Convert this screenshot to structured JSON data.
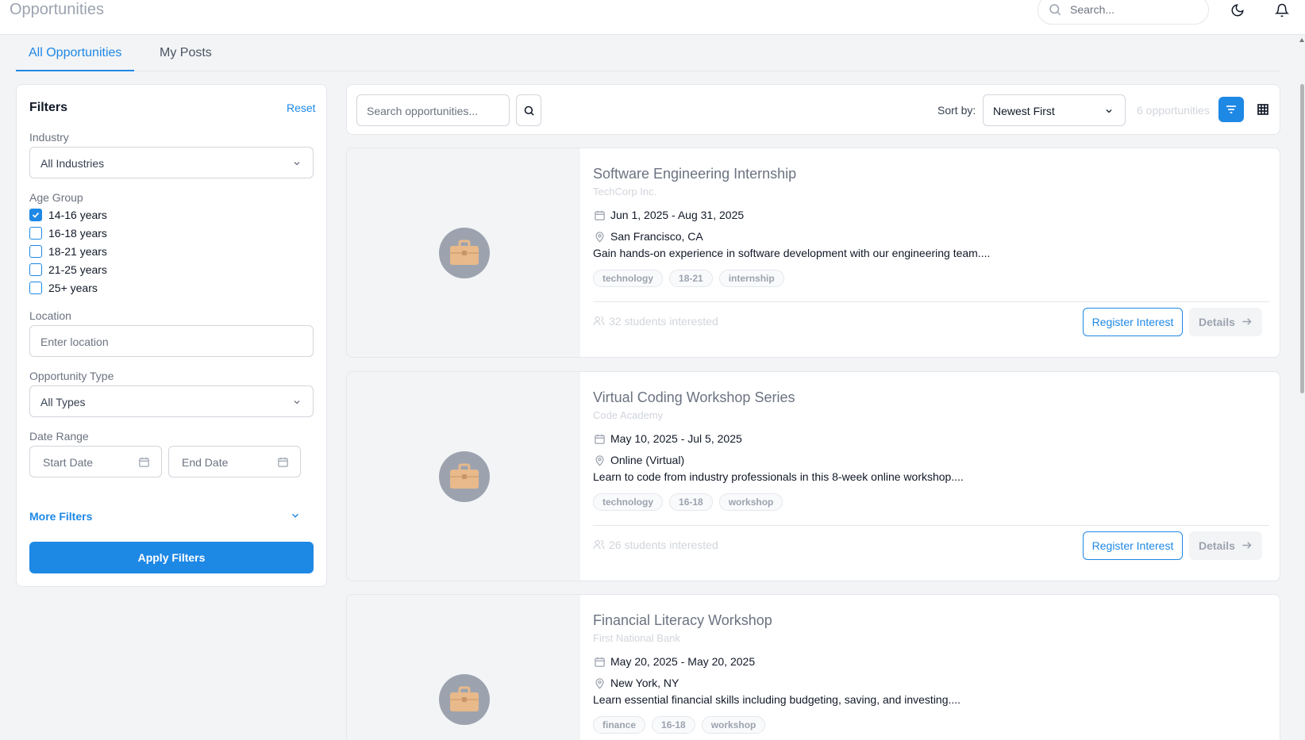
{
  "header": {
    "title": "Opportunities",
    "search_placeholder": "Search...",
    "icons": [
      "search-icon",
      "moon-icon",
      "bell-icon"
    ]
  },
  "tabs": [
    {
      "label": "All Opportunities",
      "active": true
    },
    {
      "label": "My Posts",
      "active": false
    }
  ],
  "filters": {
    "title": "Filters",
    "reset_label": "Reset",
    "industry": {
      "label": "Industry",
      "value": "All Industries"
    },
    "age_group": {
      "label": "Age Group",
      "options": [
        {
          "label": "14-16 years",
          "checked": true
        },
        {
          "label": "16-18 years",
          "checked": false
        },
        {
          "label": "18-21 years",
          "checked": false
        },
        {
          "label": "21-25 years",
          "checked": false
        },
        {
          "label": "25+ years",
          "checked": false
        }
      ]
    },
    "location": {
      "label": "Location",
      "placeholder": "Enter location"
    },
    "opportunity_type": {
      "label": "Opportunity Type",
      "value": "All Types"
    },
    "date_range": {
      "label": "Date Range",
      "start_placeholder": "Start Date",
      "end_placeholder": "End Date"
    },
    "more_filters_label": "More Filters",
    "apply_label": "Apply Filters"
  },
  "toolbar": {
    "search_placeholder": "Search opportunities...",
    "sort_label": "Sort by:",
    "sort_value": "Newest First",
    "count_text": "6 opportunities"
  },
  "cards": [
    {
      "title": "Software Engineering Internship",
      "organization": "TechCorp Inc.",
      "dates": "Jun 1, 2025 - Aug 31, 2025",
      "location": "San Francisco, CA",
      "description": "Gain hands-on experience in software development with our engineering team....",
      "tags": [
        "technology",
        "18-21",
        "internship"
      ],
      "students": "32 students interested",
      "register_label": "Register Interest",
      "details_label": "Details"
    },
    {
      "title": "Virtual Coding Workshop Series",
      "organization": "Code Academy",
      "dates": "May 10, 2025 - Jul 5, 2025",
      "location": "Online (Virtual)",
      "description": "Learn to code from industry professionals in this 8-week online workshop....",
      "tags": [
        "technology",
        "16-18",
        "workshop"
      ],
      "students": "26 students interested",
      "register_label": "Register Interest",
      "details_label": "Details"
    },
    {
      "title": "Financial Literacy Workshop",
      "organization": "First National Bank",
      "dates": "May 20, 2025 - May 20, 2025",
      "location": "New York, NY",
      "description": "Learn essential financial skills including budgeting, saving, and investing....",
      "tags": [
        "finance",
        "16-18",
        "workshop"
      ]
    }
  ],
  "colors": {
    "accent": "#1e88e5",
    "briefcase": "#e8b98a",
    "avatar_bg": "#9ca3af"
  }
}
